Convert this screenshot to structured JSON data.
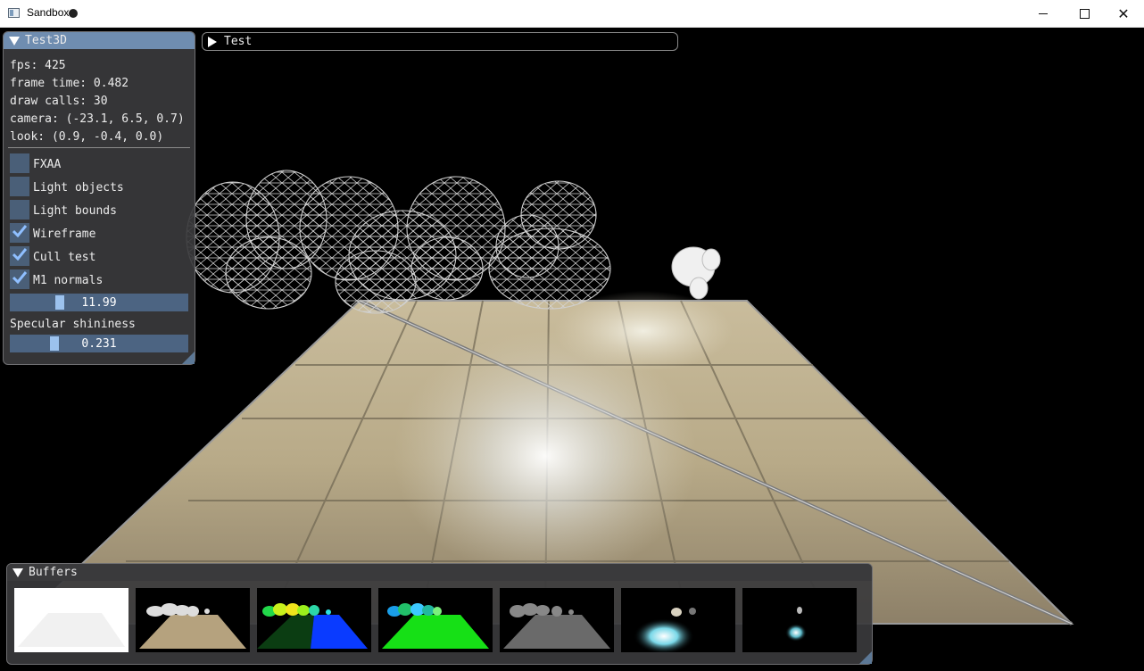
{
  "window": {
    "title": "Sandbox"
  },
  "test3d": {
    "title": "Test3D",
    "stats": [
      "fps: 425",
      "frame time: 0.482",
      "draw calls: 30",
      "camera: (-23.1, 6.5, 0.7)",
      "look: (0.9, -0.4, 0.0)"
    ],
    "checkboxes": [
      {
        "label": "FXAA",
        "checked": false
      },
      {
        "label": "Light objects",
        "checked": false
      },
      {
        "label": "Light bounds",
        "checked": false
      },
      {
        "label": "Wireframe",
        "checked": true
      },
      {
        "label": "Cull test",
        "checked": true
      },
      {
        "label": "M1 normals",
        "checked": true
      }
    ],
    "slider1": {
      "value": "11.99",
      "fraction": 0.26
    },
    "specular_label": "Specular shininess",
    "slider2": {
      "value": "0.231",
      "fraction": 0.23
    }
  },
  "test": {
    "title": "Test"
  },
  "buffers": {
    "title": "Buffers",
    "items": [
      "depth",
      "albedo",
      "normals",
      "normals-view",
      "specular",
      "lighting",
      "emissive"
    ]
  }
}
